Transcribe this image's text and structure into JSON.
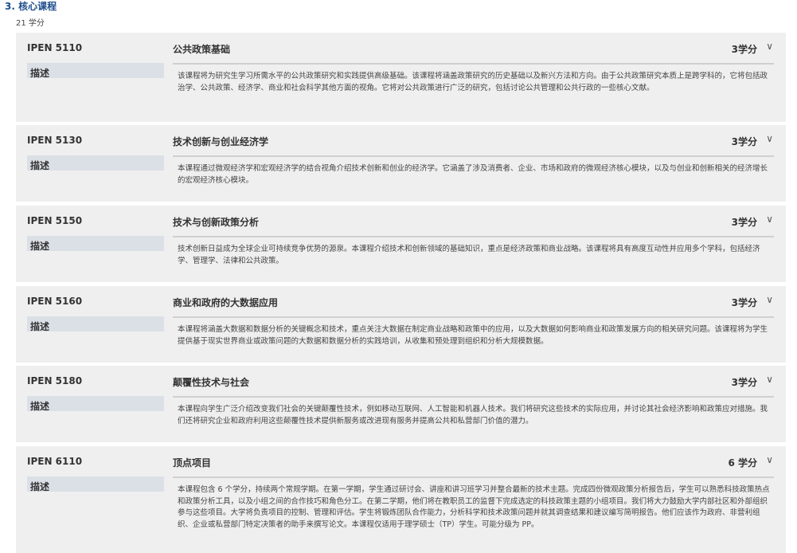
{
  "section": {
    "title": "3. 核心课程",
    "credits": "21 学分"
  },
  "desc_label": "描述",
  "courses": [
    {
      "code": "IPEN 5110",
      "title": "公共政策基础",
      "credits": "3学分",
      "description": "该课程将为研究生学习所需水平的公共政策研究和实践提供高级基础。该课程将涵盖政策研究的历史基础以及新兴方法和方向。由于公共政策研究本质上是跨学科的，它将包括政治学、公共政策、经济学、商业和社会科学其他方面的视角。它将对公共政策进行广泛的研究，包括讨论公共管理和公共行政的一些核心文献。"
    },
    {
      "code": "IPEN 5130",
      "title": "技术创新与创业经济学",
      "credits": "3学分",
      "description": "本课程通过微观经济学和宏观经济学的结合视角介绍技术创新和创业的经济学。它涵盖了涉及消费者、企业、市场和政府的微观经济核心模块，以及与创业和创新相关的经济增长的宏观经济核心模块。"
    },
    {
      "code": "IPEN 5150",
      "title": "技术与创新政策分析",
      "credits": "3学分",
      "description": "技术创新日益成为全球企业可持续竞争优势的源泉。本课程介绍技术和创新领域的基础知识，重点是经济政策和商业战略。该课程将具有高度互动性并应用多个学科，包括经济学、管理学、法律和公共政策。"
    },
    {
      "code": "IPEN 5160",
      "title": "商业和政府的大数据应用",
      "credits": "3学分",
      "description": "本课程将涵盖大数据和数据分析的关键概念和技术，重点关注大数据在制定商业战略和政策中的应用，以及大数据如何影响商业和政策发展方向的相关研究问题。该课程将为学生提供基于现实世界商业或政策问题的大数据和数据分析的实践培训，从收集和预处理到组织和分析大规模数据。"
    },
    {
      "code": "IPEN 5180",
      "title": "颠覆性技术与社会",
      "credits": "3学分",
      "description": "本课程向学生广泛介绍改变我们社会的关键颠覆性技术，例如移动互联网、人工智能和机器人技术。我们将研究这些技术的实际应用，并讨论其社会经济影响和政策应对措施。我们还将研究企业和政府利用这些颠覆性技术提供新服务或改进现有服务并提高公共和私营部门价值的潜力。"
    },
    {
      "code": "IPEN 6110",
      "title": "顶点项目",
      "credits": "6 学分",
      "description": "本课程包含 6 个学分，持续两个常规学期。在第一学期，学生通过研讨会、讲座和讲习班学习并整合最新的技术主题。完成四份微观政策分析报告后，学生可以熟悉科技政策热点和政策分析工具，以及小组之间的合作技巧和角色分工。在第二学期，他们将在教职员工的监督下完成选定的科技政策主题的小组项目。我们将大力鼓励大学内部社区和外部组织参与这些项目。大学将负责项目的控制、管理和评估。学生将锻炼团队合作能力，分析科学和技术政策问题并就其调查结果和建议编写简明报告。他们应该作为政府、非营利组织、企业或私营部门特定决策者的助手来撰写论文。本课程仅适用于理学硕士（TP）学生。可能分级为 PP。"
    }
  ]
}
